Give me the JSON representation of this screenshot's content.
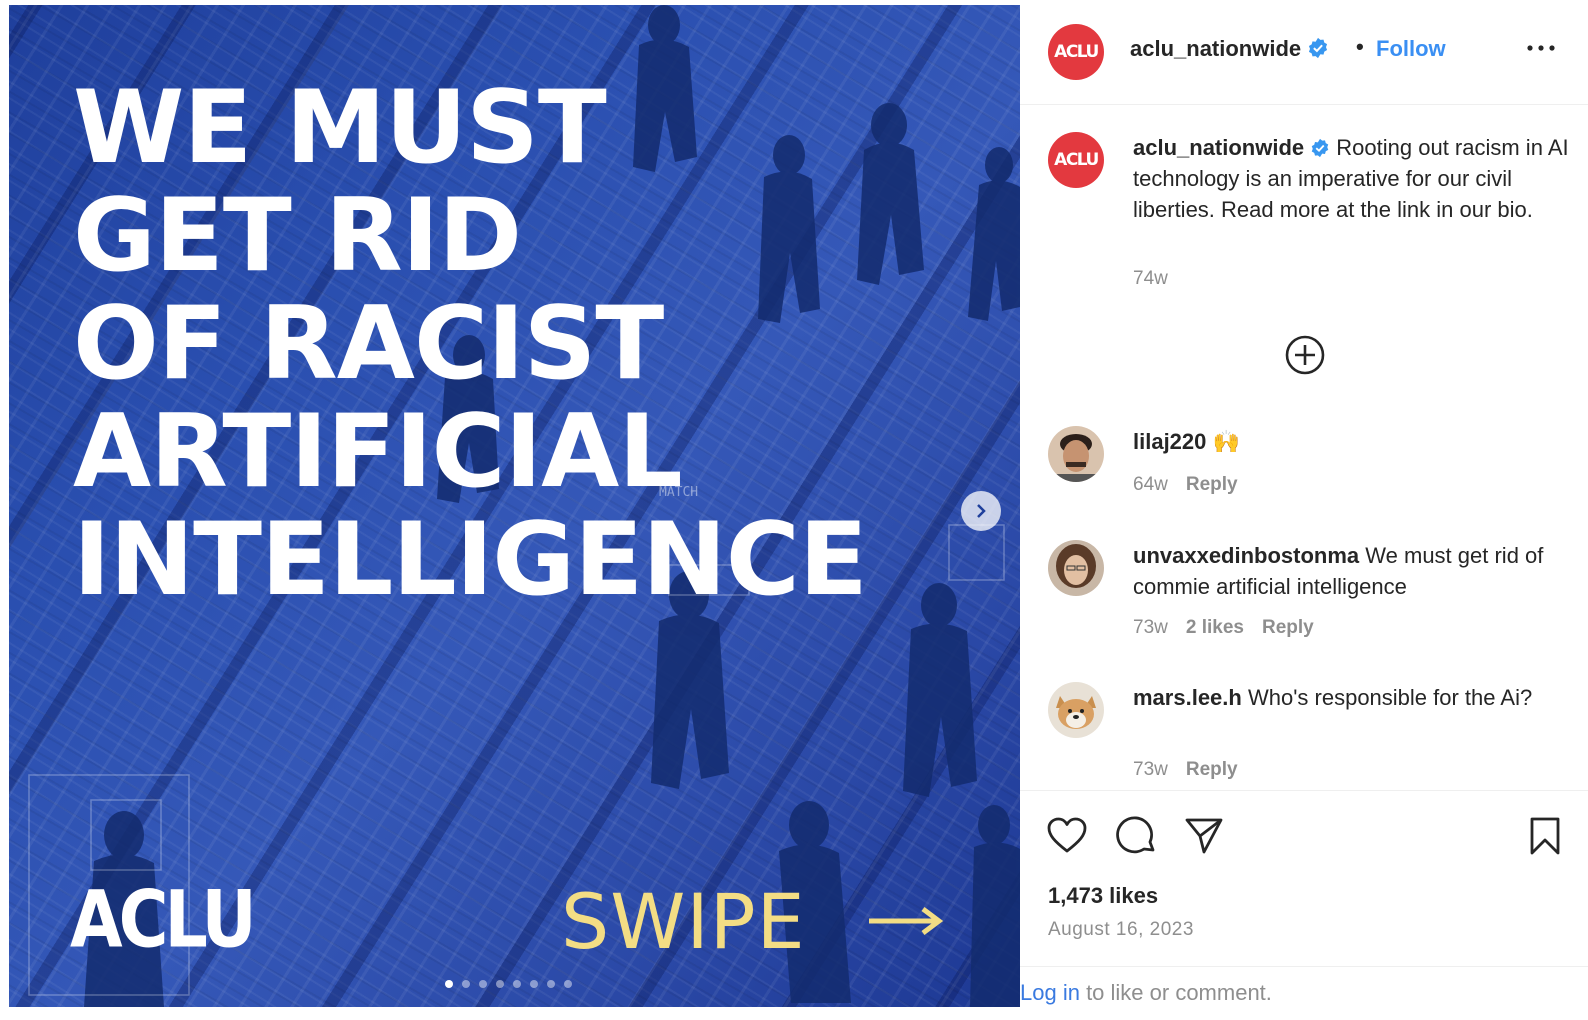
{
  "post": {
    "headline": [
      "WE MUST",
      "GET RID",
      "OF RACIST",
      "ARTIFICIAL",
      "INTELLIGENCE"
    ],
    "logo_text": "ACLU",
    "swipe_text": "SWIPE",
    "overlay_label": "MATCH",
    "carousel": {
      "total": 8,
      "active_index": 0
    }
  },
  "header": {
    "username": "aclu_nationwide",
    "avatar_text": "ACLU",
    "separator": "•",
    "follow_label": "Follow"
  },
  "caption": {
    "username": "aclu_nationwide",
    "text": "Rooting out racism in AI technology is an imperative for our civil liberties. Read more at the link in our bio.",
    "time": "74w"
  },
  "comments": [
    {
      "username": "lilaj220",
      "text": "🙌",
      "time": "64w",
      "likes": "",
      "reply": "Reply"
    },
    {
      "username": "unvaxxedinbostonma",
      "text": "We must get rid of commie artificial intelligence",
      "time": "73w",
      "likes": "2 likes",
      "reply": "Reply"
    },
    {
      "username": "mars.lee.h",
      "text": "Who's responsible for the Ai?",
      "time": "73w",
      "likes": "",
      "reply": "Reply"
    }
  ],
  "footer": {
    "likes": "1,473 likes",
    "date": "August 16, 2023",
    "login_link": "Log in",
    "login_rest": " to like or comment."
  },
  "colors": {
    "media_blue": "#2a4fb0",
    "swipe_yellow": "#f3dd84",
    "aclu_red": "#e3393f",
    "link_blue": "#3a8ff3",
    "verified_blue": "#3897f0"
  }
}
